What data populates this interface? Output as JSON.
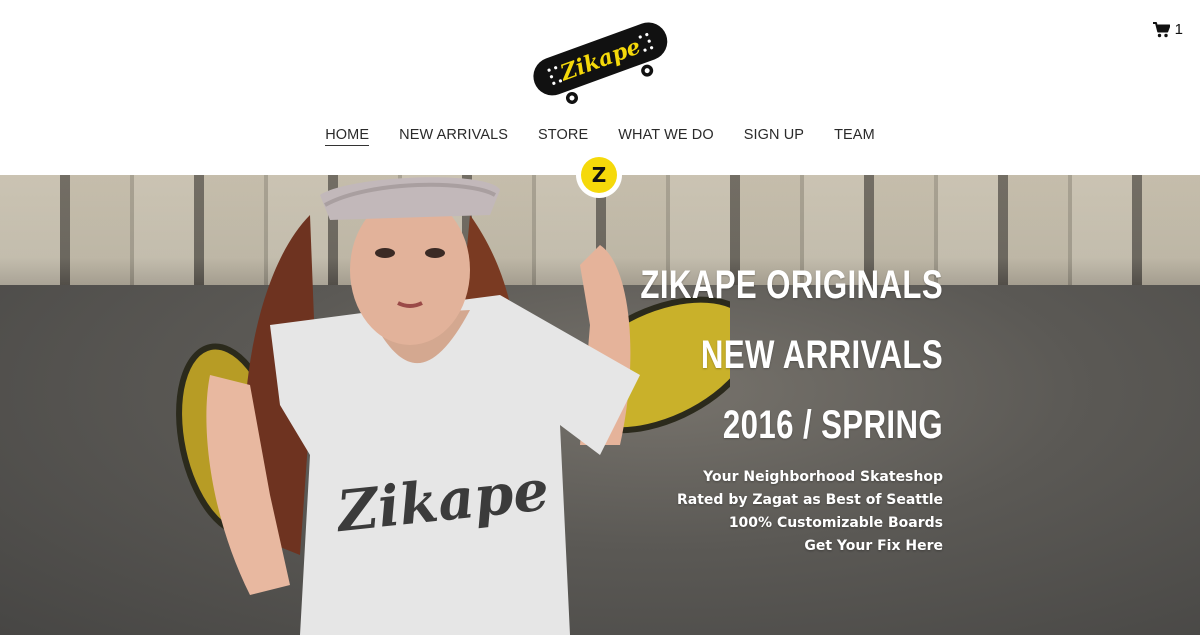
{
  "brand": {
    "logo_text": "Zikape",
    "logo_icon": "skateboard-logo"
  },
  "cart": {
    "icon": "cart-icon",
    "count": "1"
  },
  "nav": {
    "items": [
      {
        "label": "HOME",
        "active": true
      },
      {
        "label": "NEW ARRIVALS",
        "active": false
      },
      {
        "label": "STORE",
        "active": false
      },
      {
        "label": "WHAT WE DO",
        "active": false
      },
      {
        "label": "SIGN UP",
        "active": false
      },
      {
        "label": "TEAM",
        "active": false
      }
    ]
  },
  "badge": {
    "letter": "Z",
    "color": "#f5d90a"
  },
  "hero": {
    "headline": [
      "ZIKAPE ORIGINALS",
      "NEW ARRIVALS",
      "2016 / SPRING"
    ],
    "taglines": [
      "Your Neighborhood Skateshop",
      "Rated by Zagat as Best of Seattle",
      "100% Customizable Boards",
      "Get Your Fix Here"
    ],
    "shirt_text": "Zikape"
  },
  "colors": {
    "accent": "#f5d90a",
    "board": "#111111",
    "text_on_hero": "#ffffff"
  }
}
